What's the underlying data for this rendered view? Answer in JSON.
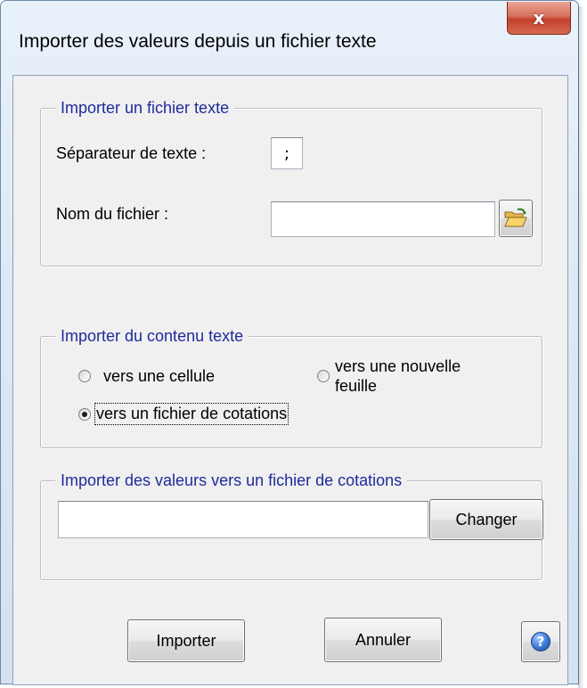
{
  "window": {
    "title": "Importer des valeurs depuis un fichier texte",
    "close_label": "x"
  },
  "group_import_file": {
    "legend": "Importer un fichier texte",
    "separator_label": "Séparateur de texte :",
    "separator_value": ";",
    "filename_label": "Nom du fichier :",
    "filename_value": "",
    "browse_icon": "folder-open-icon"
  },
  "group_import_content": {
    "legend": "Importer du contenu texte",
    "options": [
      {
        "label": "vers une cellule",
        "checked": false
      },
      {
        "label": "vers une nouvelle feuille",
        "label_line1": "vers une nouvelle",
        "label_line2": "feuille",
        "checked": false
      },
      {
        "label": "vers un fichier de cotations",
        "checked": true
      }
    ]
  },
  "group_import_values": {
    "legend": "Importer des valeurs vers un fichier de cotations",
    "path_value": "",
    "change_label": "Changer"
  },
  "footer": {
    "import_label": "Importer",
    "cancel_label": "Annuler",
    "help_icon": "help-icon",
    "help_glyph": "?"
  },
  "colors": {
    "legend_text": "#1f2a9b",
    "dialog_bg": "#f0f0f0",
    "close_button": "#c2412b"
  }
}
